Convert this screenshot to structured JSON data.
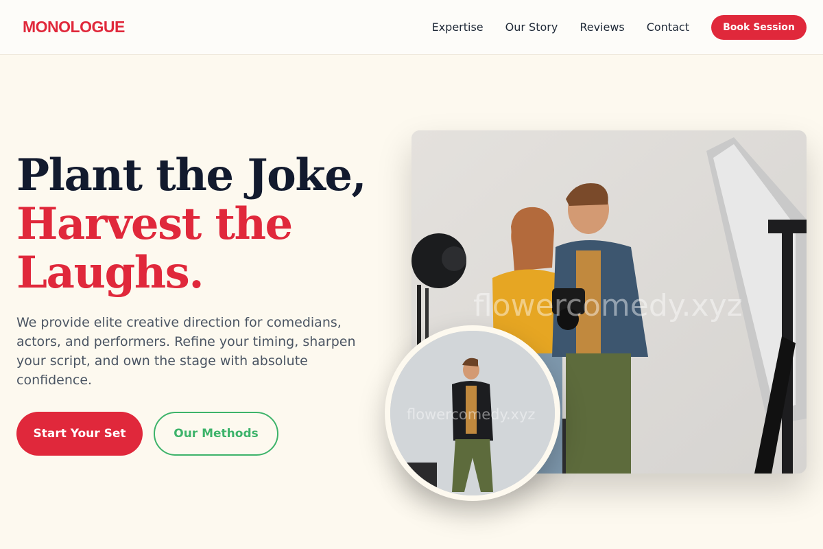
{
  "brand": {
    "logo": "MONOLOGUE",
    "accent": "#e0283b",
    "secondary": "#3db36a"
  },
  "nav": {
    "links": [
      "Expertise",
      "Our Story",
      "Reviews",
      "Contact"
    ],
    "cta": "Book Session"
  },
  "hero": {
    "title_line1": "Plant the Joke,",
    "title_line2": "Harvest the",
    "title_line3": "Laughs.",
    "description": "We provide elite creative direction for comedians, actors, and performers. Refine your timing, sharpen your script, and own the stage with absolute confidence.",
    "primary_button": "Start Your Set",
    "secondary_button": "Our Methods"
  },
  "images": {
    "watermark": "flowercomedy.xyz"
  }
}
